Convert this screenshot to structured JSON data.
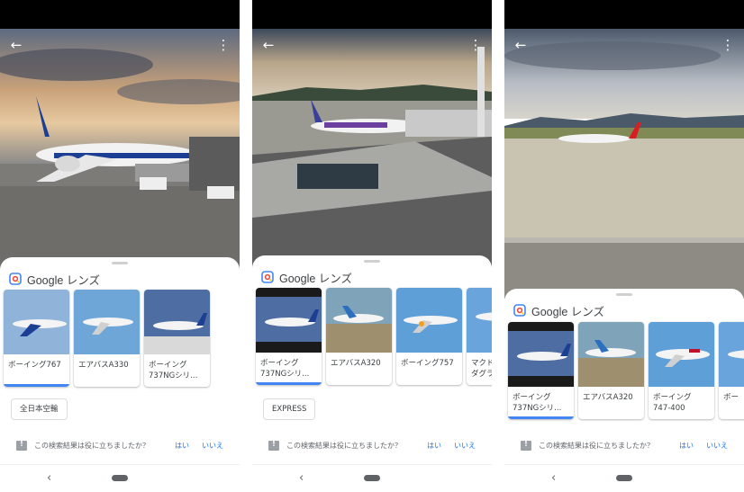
{
  "lens_title": "Google レンズ",
  "feedback_question": "この検索結果は役に立ちましたか？",
  "feedback_yes": "はい",
  "feedback_no": "いいえ",
  "colors": {
    "accent": "#4285f4",
    "link": "#1a73e8"
  },
  "icons": [
    "back-arrow-icon",
    "more-vert-icon",
    "google-lens-icon",
    "feedback-icon",
    "nav-back-icon",
    "nav-home-icon"
  ],
  "screens": [
    {
      "cards": [
        {
          "label": "ボーイング767"
        },
        {
          "label": "エアバスA330"
        },
        {
          "label": "ボーイング\n737NGシリ..."
        }
      ],
      "chip": "全日本空輸"
    },
    {
      "cards": [
        {
          "label": "ボーイング\n737NGシリ..."
        },
        {
          "label": "エアバスA320"
        },
        {
          "label": "ボーイング757"
        },
        {
          "label": "マクド\nダグラ"
        }
      ],
      "chip": "EXPRESS"
    },
    {
      "cards": [
        {
          "label": "ボーイング\n737NGシリ..."
        },
        {
          "label": "エアバスA320"
        },
        {
          "label": "ボーイング\n747-400"
        },
        {
          "label": "ボー"
        }
      ]
    }
  ]
}
